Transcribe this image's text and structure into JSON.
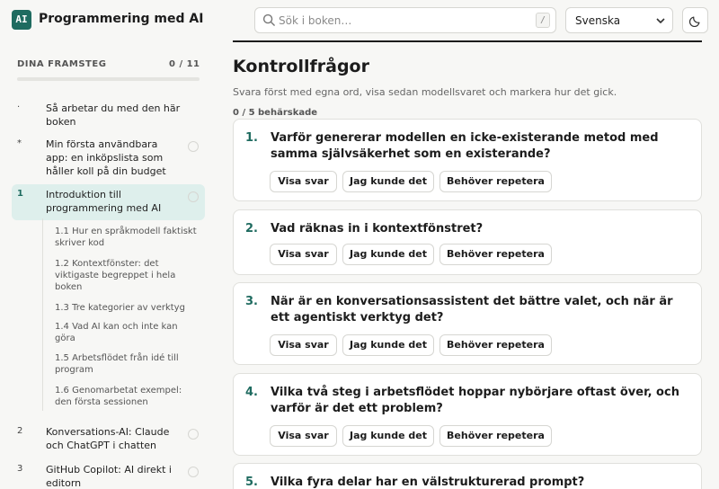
{
  "app": {
    "logo": "AI",
    "title": "Programmering med AI"
  },
  "search": {
    "placeholder": "Sök i boken…",
    "shortcut": "/"
  },
  "language": {
    "selected": "Svenska"
  },
  "icons": {
    "search": "search-icon",
    "lang_chevron": "chevron-down-icon",
    "theme": "moon-icon"
  },
  "colors": {
    "accent": "#1f6b60",
    "active_bg": "#deefec"
  },
  "sidebar": {
    "progress_label": "DINA FRAMSTEG",
    "progress_count": "0 / 11",
    "progress_fraction": 0,
    "chapters": [
      {
        "num": "·",
        "title": "Så arbetar du med den här boken"
      },
      {
        "num": "*",
        "title": "Min första användbara app: en inköpslista som håller koll på din budget"
      },
      {
        "num": "1",
        "title": "Introduktion till programmering med AI"
      },
      {
        "num": "2",
        "title": "Konversations-AI: Claude och ChatGPT i chatten"
      },
      {
        "num": "3",
        "title": "GitHub Copilot: AI direkt i editorn"
      }
    ],
    "sections": [
      {
        "label": "1.1  Hur en språkmodell faktiskt skriver kod"
      },
      {
        "label": "1.2  Kontextfönster: det viktigaste begreppet i hela boken"
      },
      {
        "label": "1.3  Tre kategorier av verktyg"
      },
      {
        "label": "1.4  Vad AI kan och inte kan göra"
      },
      {
        "label": "1.5  Arbetsflödet från idé till program"
      },
      {
        "label": "1.6  Genomarbetat exempel: den första sessionen"
      }
    ]
  },
  "main": {
    "title": "Kontrollfrågor",
    "subtitle": "Svara först med egna ord, visa sedan modellsvaret och markera hur det gick.",
    "mastered": "0 / 5 behärskade",
    "button_labels": {
      "show": "Visa svar",
      "knew": "Jag kunde det",
      "repeat": "Behöver repetera"
    },
    "questions": [
      {
        "num": "1.",
        "text": "Varför genererar modellen en icke-existerande metod med samma självsäkerhet som en existerande?"
      },
      {
        "num": "2.",
        "text": "Vad räknas in i kontextfönstret?"
      },
      {
        "num": "3.",
        "text": "När är en konversationsassistent det bättre valet, och när är ett agentiskt verktyg det?"
      },
      {
        "num": "4.",
        "text": "Vilka två steg i arbetsflödet hoppar nybörjare oftast över, och varför är det ett problem?"
      },
      {
        "num": "5.",
        "text": "Vilka fyra delar har en välstrukturerad prompt?"
      }
    ]
  }
}
